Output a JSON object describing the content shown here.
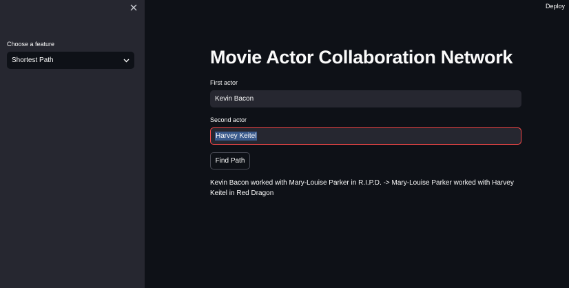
{
  "sidebar": {
    "feature_label": "Choose a feature",
    "feature_selected": "Shortest Path"
  },
  "header": {
    "deploy_label": "Deploy"
  },
  "main": {
    "title": "Movie Actor Collaboration Network",
    "first_actor": {
      "label": "First actor",
      "value": "Kevin Bacon"
    },
    "second_actor": {
      "label": "Second actor",
      "value": "Harvey Keitel"
    },
    "find_button": "Find Path",
    "result": "Kevin Bacon worked with Mary-Louise Parker in R.I.P.D. -> Mary-Louise Parker worked with Harvey Keitel in Red Dragon"
  },
  "colors": {
    "sidebar_bg": "#262730",
    "main_bg": "#0e1117",
    "focus_border": "#ff4b4b",
    "selection": "#3a5a8c"
  }
}
